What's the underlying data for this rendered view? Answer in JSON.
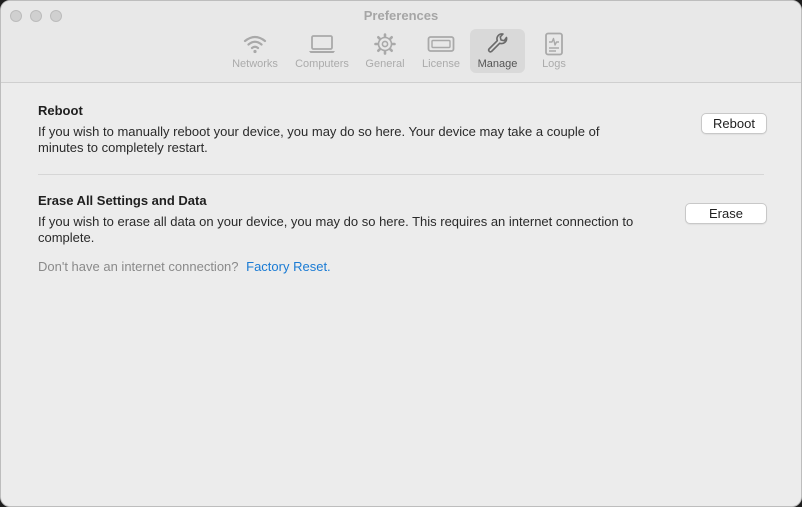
{
  "window": {
    "title": "Preferences"
  },
  "toolbar": {
    "tabs": [
      {
        "label": "Networks",
        "icon": "wifi-icon",
        "active": false
      },
      {
        "label": "Computers",
        "icon": "laptop-icon",
        "active": false
      },
      {
        "label": "General",
        "icon": "gear-icon",
        "active": false
      },
      {
        "label": "License",
        "icon": "license-icon",
        "active": false
      },
      {
        "label": "Manage",
        "icon": "wrench-icon",
        "active": true
      },
      {
        "label": "Logs",
        "icon": "log-document-icon",
        "active": false
      }
    ]
  },
  "reboot": {
    "title": "Reboot",
    "description": "If you wish to manually reboot your device, you may do so here. Your device may take a couple of minutes to completely restart.",
    "button_label": "Reboot"
  },
  "erase": {
    "title": "Erase All Settings and Data",
    "description": "If you wish to erase all data on your device, you may do so here. This requires an internet connection to complete.",
    "button_label": "Erase",
    "hint_text": "Don't have an internet connection?",
    "link_text": "Factory Reset."
  },
  "colors": {
    "accent_link": "#1a7bd4",
    "window_bg": "#ececec",
    "active_tab_bg": "#d9d9d9"
  }
}
